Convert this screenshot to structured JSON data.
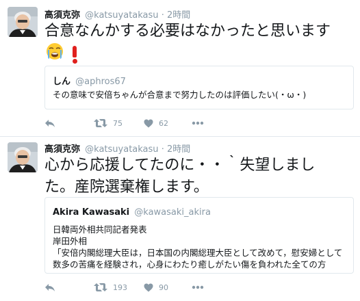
{
  "tweets": [
    {
      "author_name": "高須克弥",
      "handle": "@katsuyatakasu",
      "separator": "·",
      "time": "2時間",
      "text": "合意なんかする必要はなかったと思います",
      "emojis": [
        "loudly-crying-face-icon",
        "red-exclamation-icon"
      ],
      "quoted": {
        "author_name": "しん",
        "handle": "@aphros67",
        "lines": [
          "その意味で安倍ちゃんが合意まで努力したのは評価したい(・ω・)"
        ]
      },
      "retweets": "75",
      "likes": "62"
    },
    {
      "author_name": "高須克弥",
      "handle": "@katsuyatakasu",
      "separator": "·",
      "time": "2時間",
      "text_line1": "心から応援してたのに・・｀失望しまし",
      "text_line2": "た。産院選棄権します。",
      "quoted": {
        "author_name": "Akira Kawasaki",
        "handle": "@kawasaki_akira",
        "lines": [
          "日韓両外相共同記者発表",
          "岸田外相",
          "「安倍内閣総理大臣は，日本国の内閣総理大臣として改めて，慰安婦として",
          "数多の苦痛を経験され，心身にわたり癒しがたい傷を負われた全ての方"
        ]
      },
      "retweets": "193",
      "likes": "90"
    }
  ],
  "colors": {
    "text": "#14171a",
    "muted": "#8899a6",
    "border": "#e1e8ed",
    "exclamation": "#e0201d"
  }
}
